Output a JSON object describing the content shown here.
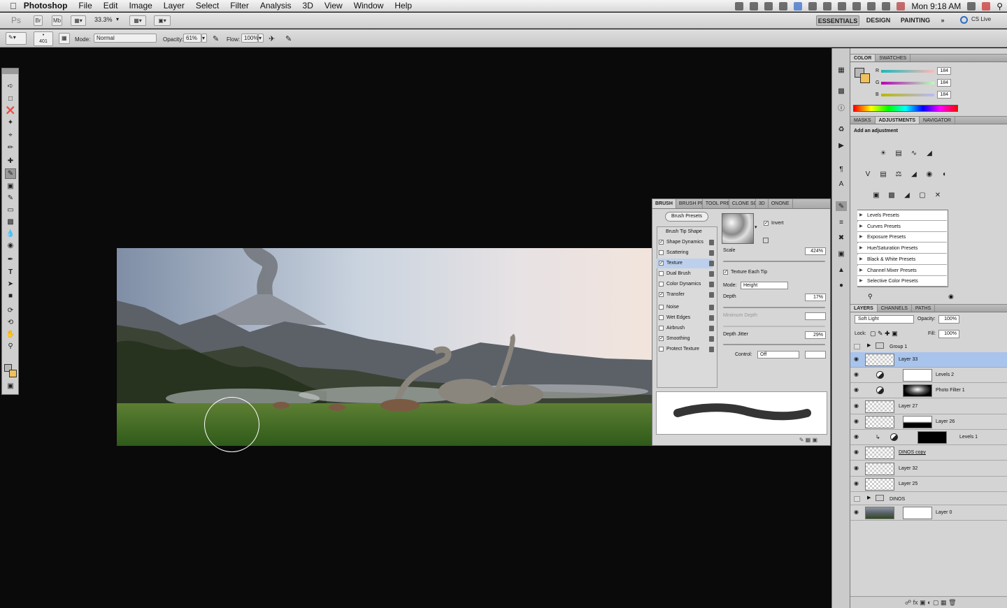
{
  "menubar": {
    "app": "Photoshop",
    "items": [
      "File",
      "Edit",
      "Image",
      "Layer",
      "Select",
      "Filter",
      "Analysis",
      "3D",
      "View",
      "Window",
      "Help"
    ],
    "clock": "Mon 9:18 AM"
  },
  "appbar": {
    "ps": "Ps",
    "br": "Br",
    "mb": "Mb",
    "zoom": "33.3%",
    "workspaces": [
      "ESSENTIALS",
      "DESIGN",
      "PAINTING"
    ],
    "more": "»",
    "cslive": "CS Live"
  },
  "options": {
    "brush_size": "401",
    "mode_label": "Mode:",
    "mode_value": "Normal",
    "opacity_label": "Opacity:",
    "opacity_value": "61%",
    "flow_label": "Flow:",
    "flow_value": "100%"
  },
  "brush_panel": {
    "tabs": [
      "BRUSH",
      "BRUSH PR",
      "TOOL PRE",
      "CLONE SO",
      "3D",
      "ONONE"
    ],
    "presets_button": "Brush Presets",
    "tip_shape": "Brush Tip Shape",
    "items": [
      {
        "label": "Shape Dynamics",
        "checked": true
      },
      {
        "label": "Scattering",
        "checked": false
      },
      {
        "label": "Texture",
        "checked": true
      },
      {
        "label": "Dual Brush",
        "checked": false
      },
      {
        "label": "Color Dynamics",
        "checked": false
      },
      {
        "label": "Transfer",
        "checked": true
      },
      {
        "label": "Noise",
        "checked": false
      },
      {
        "label": "Wet Edges",
        "checked": false
      },
      {
        "label": "Airbrush",
        "checked": false
      },
      {
        "label": "Smoothing",
        "checked": true
      },
      {
        "label": "Protect Texture",
        "checked": false
      }
    ],
    "invert_label": "Invert",
    "scale_label": "Scale",
    "scale_value": "424%",
    "texture_each_tip": "Texture Each Tip",
    "mode_label": "Mode:",
    "mode_value": "Height",
    "depth_label": "Depth",
    "depth_value": "17%",
    "min_depth_label": "Minimum Depth",
    "depth_jitter_label": "Depth Jitter",
    "depth_jitter_value": "29%",
    "control_label": "Control:",
    "control_value": "Off"
  },
  "color_panel": {
    "tabs": [
      "COLOR",
      "SWATCHES"
    ],
    "r_label": "R",
    "r_value": "184",
    "g_label": "G",
    "g_value": "184",
    "b_label": "B",
    "b_value": "184"
  },
  "adjustments_panel": {
    "tabs": [
      "MASKS",
      "ADJUSTMENTS",
      "NAVIGATOR"
    ],
    "title": "Add an adjustment",
    "presets": [
      "Levels Presets",
      "Curves Presets",
      "Exposure Presets",
      "Hue/Saturation Presets",
      "Black & White Presets",
      "Channel Mixer Presets",
      "Selective Color Presets"
    ]
  },
  "layers_panel": {
    "tabs": [
      "LAYERS",
      "CHANNELS",
      "PATHS"
    ],
    "blend_mode": "Soft Light",
    "opacity_label": "Opacity:",
    "opacity_value": "100%",
    "lock_label": "Lock:",
    "fill_label": "Fill:",
    "fill_value": "100%",
    "layers": [
      "Group 1",
      "Layer 33",
      "Levels 2",
      "Photo Filter 1",
      "Layer 27",
      "Layer 26",
      "Levels 1",
      "DINOS copy",
      "Layer 32",
      "Layer 25",
      "DINOS",
      "Layer 0"
    ]
  },
  "colors": {
    "selection": "#a9c4ec",
    "foreground": "#b8b8b8",
    "background": "#f0c05a"
  }
}
